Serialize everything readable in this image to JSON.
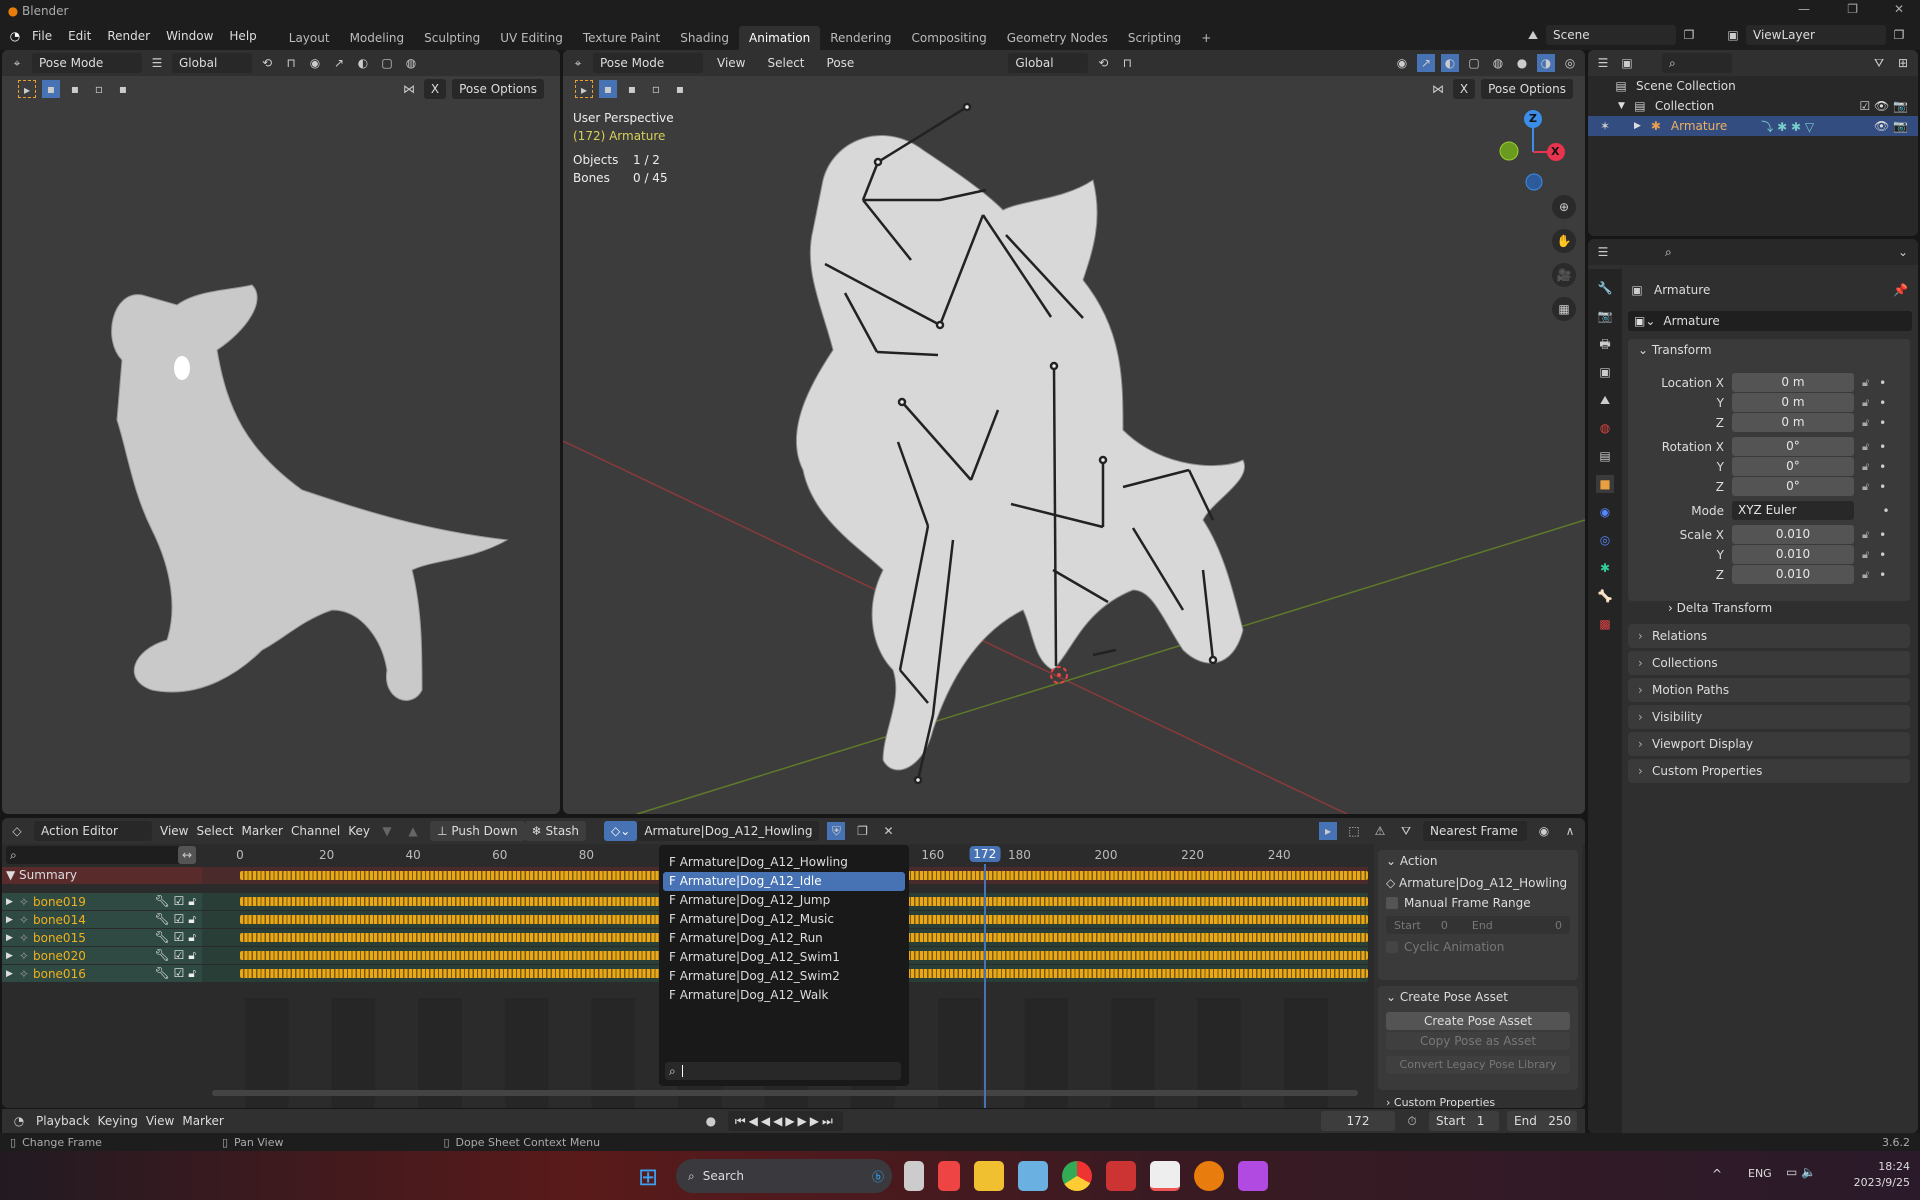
{
  "app": {
    "title": "Blender",
    "version": "3.6.2"
  },
  "menu": [
    "File",
    "Edit",
    "Render",
    "Window",
    "Help"
  ],
  "workspaces": [
    "Layout",
    "Modeling",
    "Sculpting",
    "UV Editing",
    "Texture Paint",
    "Shading",
    "Animation",
    "Rendering",
    "Compositing",
    "Geometry Nodes",
    "Scripting",
    "+"
  ],
  "active_workspace": "Animation",
  "scene": {
    "scene_name": "Scene",
    "view_layer": "ViewLayer"
  },
  "left_viewport": {
    "mode": "Pose Mode",
    "orientation": "Global",
    "pose_options": "Pose Options",
    "x_label": "X"
  },
  "right_viewport": {
    "mode": "Pose Mode",
    "menus": [
      "View",
      "Select",
      "Pose"
    ],
    "orientation": "Global",
    "pose_options": "Pose Options",
    "x_label": "X",
    "overlay": {
      "perspective": "User Perspective",
      "active": "(172) Armature",
      "objects_label": "Objects",
      "objects_value": "1 / 2",
      "bones_label": "Bones",
      "bones_value": "0 / 45"
    },
    "gizmo": {
      "z": "Z",
      "x": "X"
    }
  },
  "outliner": {
    "items": [
      {
        "label": "Scene Collection"
      },
      {
        "label": "Collection"
      },
      {
        "label": "Armature"
      }
    ]
  },
  "properties": {
    "object_name": "Armature",
    "data_name": "Armature",
    "transform_title": "Transform",
    "rows": [
      {
        "label": "Location X",
        "value": "0 m"
      },
      {
        "label": "Y",
        "value": "0 m"
      },
      {
        "label": "Z",
        "value": "0 m"
      },
      {
        "label": "Rotation X",
        "value": "0°"
      },
      {
        "label": "Y",
        "value": "0°"
      },
      {
        "label": "Z",
        "value": "0°"
      },
      {
        "label": "Mode",
        "value": "XYZ Euler"
      },
      {
        "label": "Scale X",
        "value": "0.010"
      },
      {
        "label": "Y",
        "value": "0.010"
      },
      {
        "label": "Z",
        "value": "0.010"
      }
    ],
    "delta": "Delta Transform",
    "sections": [
      "Relations",
      "Collections",
      "Motion Paths",
      "Visibility",
      "Viewport Display",
      "Custom Properties"
    ]
  },
  "dopesheet": {
    "editor": "Action Editor",
    "menus": [
      "View",
      "Select",
      "Marker",
      "Channel",
      "Key"
    ],
    "push_down": "Push Down",
    "stash": "Stash",
    "action": "Armature|Dog_A12_Howling",
    "snap": "Nearest Frame",
    "ticks": [
      0,
      20,
      40,
      60,
      80,
      160,
      180,
      200,
      220,
      240
    ],
    "current_frame": 172,
    "summary": "Summary",
    "channels": [
      "bone019",
      "bone014",
      "bone015",
      "bone020",
      "bone016"
    ],
    "action_list": [
      "F Armature|Dog_A12_Howling",
      "F Armature|Dog_A12_Idle",
      "F Armature|Dog_A12_Jump",
      "F Armature|Dog_A12_Music",
      "F Armature|Dog_A12_Run",
      "F Armature|Dog_A12_Swim1",
      "F Armature|Dog_A12_Swim2",
      "F Armature|Dog_A12_Walk"
    ],
    "action_list_selected": 1,
    "panel": {
      "action_title": "Action",
      "action_name": "Armature|Dog_A12_Howling",
      "manual_range": "Manual Frame Range",
      "start_label": "Start",
      "start": "0",
      "end_label": "End",
      "end": "0",
      "cyclic": "Cyclic Animation",
      "pose_title": "Create Pose Asset",
      "create_pose": "Create Pose Asset",
      "copy_pose": "Copy Pose as Asset",
      "convert": "Convert Legacy Pose Library",
      "custom": "Custom Properties"
    }
  },
  "timeline": {
    "menus": [
      "Playback",
      "Keying",
      "View",
      "Marker"
    ],
    "frame": "172",
    "start_label": "Start",
    "start": "1",
    "end_label": "End",
    "end": "250"
  },
  "statusbar": {
    "items": [
      "Change Frame",
      "Pan View",
      "Dope Sheet Context Menu"
    ]
  },
  "taskbar": {
    "search": "Search",
    "lang": "ENG",
    "time": "18:24",
    "date": "2023/9/25"
  }
}
